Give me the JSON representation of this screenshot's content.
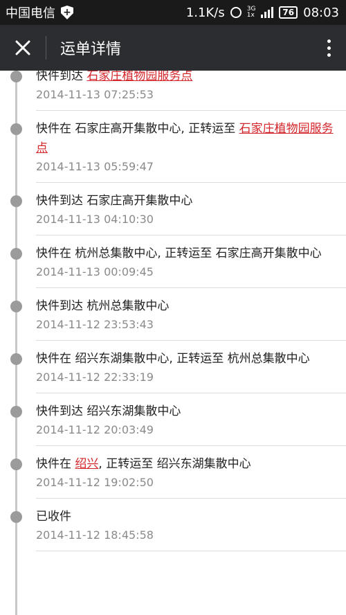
{
  "statusbar": {
    "carrier": "中国电信",
    "speed": "1.1K/s",
    "network": "3G",
    "network_sub": "1x",
    "battery": "76",
    "time": "08:03"
  },
  "appbar": {
    "title": "运单详情"
  },
  "entries": [
    {
      "prefix": "快件到达 ",
      "link": "石家庄植物园服务点",
      "suffix": "",
      "time": "2014-11-13 07:25:53"
    },
    {
      "prefix": "快件在 石家庄高开集散中心, 正转运至 ",
      "link": "石家庄植物园服务点",
      "suffix": "",
      "time": "2014-11-13 05:59:47"
    },
    {
      "prefix": "快件到达 石家庄高开集散中心",
      "link": "",
      "suffix": "",
      "time": "2014-11-13 04:10:30"
    },
    {
      "prefix": "快件在 杭州总集散中心, 正转运至 石家庄高开集散中心",
      "link": "",
      "suffix": "",
      "time": "2014-11-13 00:09:45"
    },
    {
      "prefix": "快件到达 杭州总集散中心",
      "link": "",
      "suffix": "",
      "time": "2014-11-12 23:53:43"
    },
    {
      "prefix": "快件在 绍兴东湖集散中心, 正转运至 杭州总集散中心",
      "link": "",
      "suffix": "",
      "time": "2014-11-12 22:33:19"
    },
    {
      "prefix": "快件到达 绍兴东湖集散中心",
      "link": "",
      "suffix": "",
      "time": "2014-11-12 20:03:49"
    },
    {
      "prefix": "快件在 ",
      "link": "绍兴",
      "suffix": ", 正转运至 绍兴东湖集散中心",
      "time": "2014-11-12 19:02:50"
    },
    {
      "prefix": "已收件",
      "link": "",
      "suffix": "",
      "time": "2014-11-12 18:45:58"
    }
  ],
  "colors": {
    "link": "#d4262a",
    "appbar": "#2b2d30",
    "timeline_dot": "#9b9b9b"
  }
}
